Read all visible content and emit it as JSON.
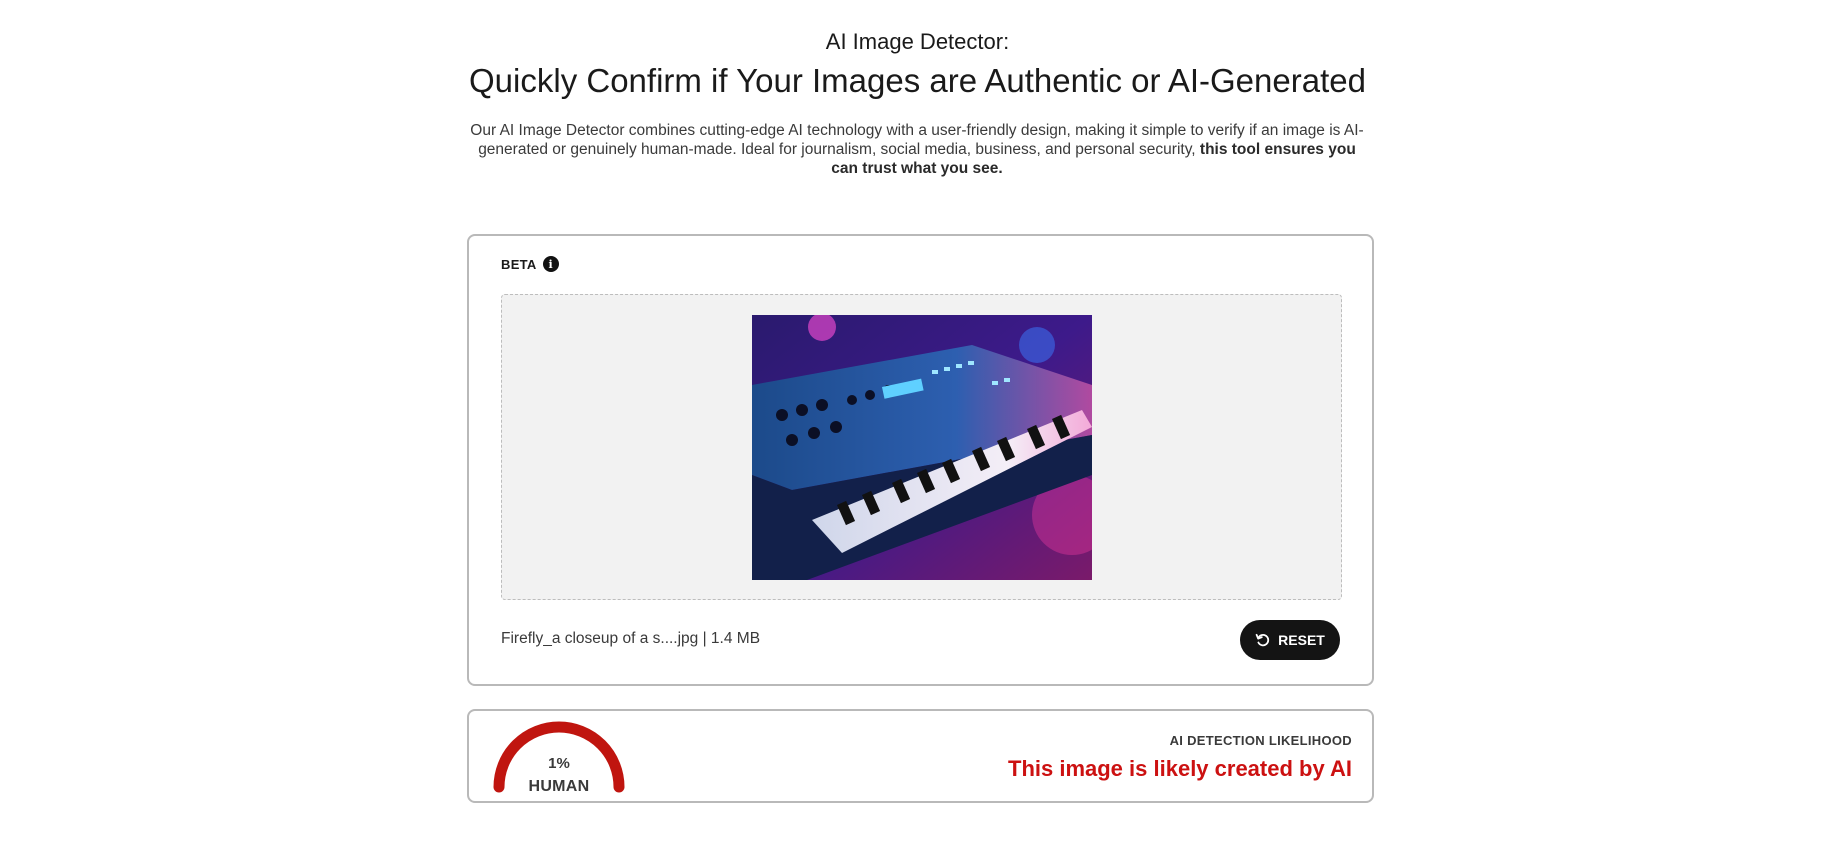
{
  "hero": {
    "kicker": "AI Image Detector:",
    "title": "Quickly Confirm if Your Images are Authentic or AI-Generated",
    "description_plain": "Our AI Image Detector combines cutting-edge AI technology with a user-friendly design, making it simple to verify if an image is AI-generated or genuinely human-made. Ideal for journalism, social media, business, and personal security, ",
    "description_bold": "this tool ensures you can trust what you see."
  },
  "upload": {
    "beta_label": "BETA",
    "info_icon": "info-icon",
    "file_info": "Firefly_a closeup of a s....jpg | 1.4 MB",
    "reset_label": "RESET",
    "reset_icon": "reset-icon"
  },
  "result": {
    "gauge_percent": "1%",
    "gauge_label": "HUMAN",
    "gauge_value_fraction": 0.01,
    "likelihood_label": "AI DETECTION LIKELIHOOD",
    "verdict": "This image is likely created by AI",
    "verdict_color": "#cc1111",
    "gauge_color": "#c0150f"
  }
}
